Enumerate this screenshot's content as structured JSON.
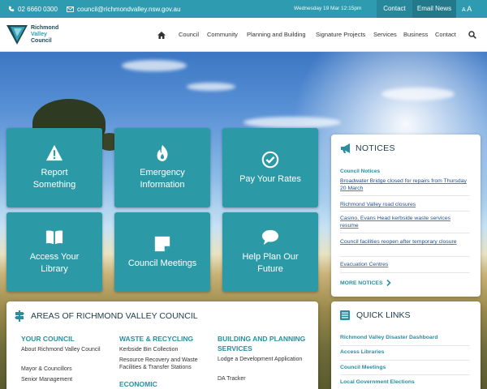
{
  "topbar": {
    "phone": "02 6660 0300",
    "email": "council@richmondvalley.nsw.gov.au",
    "date": "Wednesday 19 Mar 12:15pm",
    "contact_label": "Contact",
    "news_label": "Email News",
    "font_small": "A",
    "font_large": "A"
  },
  "logo": {
    "line1": "Richmond",
    "line2": "Valley",
    "line3": "Council"
  },
  "nav": {
    "home_icon": "home-icon",
    "items": [
      "Council",
      "Community",
      "Planning and Building",
      "Signature Projects",
      "Services",
      "Business",
      "Contact"
    ],
    "search_icon": "search-icon"
  },
  "tiles": [
    {
      "label": "Report Something",
      "icon": "warning-icon"
    },
    {
      "label": "Emergency Information",
      "icon": "flame-icon"
    },
    {
      "label": "Pay Your Rates",
      "icon": "check-circle-icon"
    },
    {
      "label": "Access Your Library",
      "icon": "book-icon"
    },
    {
      "label": "Council Meetings",
      "icon": "note-icon"
    },
    {
      "label": "Help Plan Our Future",
      "icon": "chat-icon"
    }
  ],
  "notices": {
    "title": "NOTICES",
    "subheading": "Council Notices",
    "items": [
      "Broadwater Bridge closed for repairs from Thursday 20 March",
      "Richmond Valley road closures",
      "Casino, Evans Head kerbside waste services resume",
      "Council facilities reopen after temporary closure",
      "Evacuation Centres"
    ],
    "more_label": "MORE NOTICES"
  },
  "areas": {
    "title": "AREAS OF RICHMOND VALLEY COUNCIL",
    "columns": [
      {
        "heading": "YOUR COUNCIL",
        "items": [
          "About Richmond Valley Council",
          "Mayor & Councillors",
          "Senior Management"
        ]
      },
      {
        "heading": "WASTE & RECYCLING",
        "items": [
          "Kerbside Bin Collection",
          "Resource Recovery and Waste Facilities & Transfer Stations"
        ],
        "heading2": "ECONOMIC"
      },
      {
        "heading": "BUILDING AND PLANNING SERVICES",
        "items": [
          "Lodge a Development Application",
          "DA Tracker"
        ]
      }
    ]
  },
  "quick_links": {
    "title": "QUICK LINKS",
    "items": [
      "Richmond Valley Disaster Dashboard",
      "Access Libraries",
      "Council Meetings",
      "Local Government Elections"
    ]
  },
  "colors": {
    "primary": "#2f9bb0",
    "tile": "#2c9aa6",
    "heading": "#2a8ea0",
    "navy": "#1e3c48"
  }
}
